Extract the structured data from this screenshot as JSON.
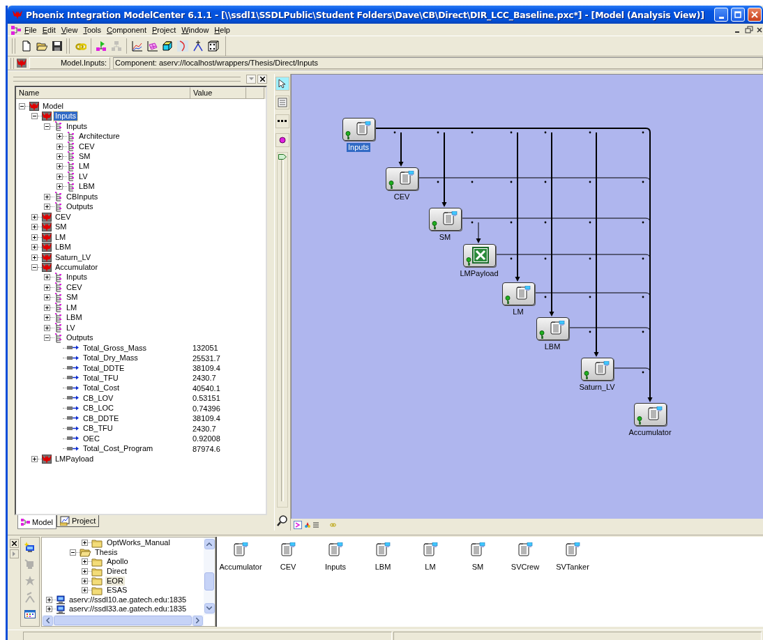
{
  "window": {
    "title": "Phoenix Integration ModelCenter 6.1.1 - [\\\\ssdl1\\SSDLPublic\\Student Folders\\Dave\\CB\\Direct\\DIR_LCC_Baseline.pxc*] - [Model (Analysis View)]"
  },
  "menu": [
    "File",
    "Edit",
    "View",
    "Tools",
    "Component",
    "Project",
    "Window",
    "Help"
  ],
  "toolbar": [
    {
      "disabled": false
    },
    {
      "disabled": false
    },
    {
      "disabled": false
    },
    {
      "disabled": false
    },
    {
      "disabled": false
    },
    {
      "disabled": true
    },
    {
      "disabled": false
    },
    {
      "disabled": false
    },
    {
      "disabled": false
    },
    {
      "disabled": false
    },
    {
      "disabled": false
    },
    {
      "disabled": false
    }
  ],
  "address_bar": {
    "label": "Model.Inputs:",
    "value": "Component: aserv://localhost/wrappers/Thesis/Direct/Inputs"
  },
  "model_tree": {
    "columns": [
      "Name",
      "Value"
    ],
    "items": [
      {
        "label": "Model",
        "kind": "model",
        "expanded": true,
        "selected": false,
        "children": [
          {
            "label": "Inputs",
            "kind": "component",
            "expanded": true,
            "selected": true,
            "children": [
              {
                "label": "Inputs",
                "kind": "group",
                "expanded": true,
                "selected": false,
                "children": [
                  {
                    "label": "Architecture",
                    "kind": "group",
                    "expanded": false,
                    "selected": false
                  },
                  {
                    "label": "CEV",
                    "kind": "group",
                    "expanded": false,
                    "selected": false
                  },
                  {
                    "label": "SM",
                    "kind": "group",
                    "expanded": false,
                    "selected": false
                  },
                  {
                    "label": "LM",
                    "kind": "group",
                    "expanded": false,
                    "selected": false
                  },
                  {
                    "label": "LV",
                    "kind": "group",
                    "expanded": false,
                    "selected": false
                  },
                  {
                    "label": "LBM",
                    "kind": "group",
                    "expanded": false,
                    "selected": false
                  }
                ]
              },
              {
                "label": "CBInputs",
                "kind": "group",
                "expanded": false,
                "selected": false
              },
              {
                "label": "Outputs",
                "kind": "group",
                "expanded": false,
                "selected": false
              }
            ]
          },
          {
            "label": "CEV",
            "kind": "component",
            "expanded": false,
            "selected": false
          },
          {
            "label": "SM",
            "kind": "component",
            "expanded": false,
            "selected": false
          },
          {
            "label": "LM",
            "kind": "component",
            "expanded": false,
            "selected": false
          },
          {
            "label": "LBM",
            "kind": "component",
            "expanded": false,
            "selected": false
          },
          {
            "label": "Saturn_LV",
            "kind": "component",
            "expanded": false,
            "selected": false
          },
          {
            "label": "Accumulator",
            "kind": "component",
            "expanded": true,
            "selected": false,
            "children": [
              {
                "label": "Inputs",
                "kind": "group",
                "expanded": false,
                "selected": false
              },
              {
                "label": "CEV",
                "kind": "group",
                "expanded": false,
                "selected": false
              },
              {
                "label": "SM",
                "kind": "group",
                "expanded": false,
                "selected": false
              },
              {
                "label": "LM",
                "kind": "group",
                "expanded": false,
                "selected": false
              },
              {
                "label": "LBM",
                "kind": "group",
                "expanded": false,
                "selected": false
              },
              {
                "label": "LV",
                "kind": "group",
                "expanded": false,
                "selected": false
              },
              {
                "label": "Outputs",
                "kind": "group",
                "expanded": true,
                "selected": false,
                "children": [
                  {
                    "label": "Total_Gross_Mass",
                    "kind": "variable",
                    "value": "132051",
                    "selected": false
                  },
                  {
                    "label": "Total_Dry_Mass",
                    "kind": "variable",
                    "value": "25531.7",
                    "selected": false
                  },
                  {
                    "label": "Total_DDTE",
                    "kind": "variable",
                    "value": "38109.4",
                    "selected": false
                  },
                  {
                    "label": "Total_TFU",
                    "kind": "variable",
                    "value": "2430.7",
                    "selected": false
                  },
                  {
                    "label": "Total_Cost",
                    "kind": "variable",
                    "value": "40540.1",
                    "selected": false
                  },
                  {
                    "label": "CB_LOV",
                    "kind": "variable",
                    "value": "0.53151",
                    "selected": false
                  },
                  {
                    "label": "CB_LOC",
                    "kind": "variable",
                    "value": "0.74396",
                    "selected": false
                  },
                  {
                    "label": "CB_DDTE",
                    "kind": "variable",
                    "value": "38109.4",
                    "selected": false
                  },
                  {
                    "label": "CB_TFU",
                    "kind": "variable",
                    "value": "2430.7",
                    "selected": false
                  },
                  {
                    "label": "OEC",
                    "kind": "variable",
                    "value": "0.92008",
                    "selected": false
                  },
                  {
                    "label": "Total_Cost_Program",
                    "kind": "variable",
                    "value": "87974.6",
                    "selected": false
                  }
                ]
              }
            ]
          },
          {
            "label": "LMPayload",
            "kind": "component",
            "expanded": false,
            "selected": false
          }
        ]
      }
    ]
  },
  "panel_tabs": [
    {
      "label": "Model",
      "selected": true
    },
    {
      "label": "Project",
      "selected": false
    }
  ],
  "zoom_slider": {
    "level": 1
  },
  "diagram": {
    "nodes": [
      {
        "label": "Inputs",
        "kind": "script",
        "selected": true
      },
      {
        "label": "CEV",
        "kind": "script",
        "selected": false
      },
      {
        "label": "SM",
        "kind": "script",
        "selected": false
      },
      {
        "label": "LMPayload",
        "kind": "spreadsheet",
        "selected": false
      },
      {
        "label": "LM",
        "kind": "script",
        "selected": false
      },
      {
        "label": "LBM",
        "kind": "script",
        "selected": false
      },
      {
        "label": "Saturn_LV",
        "kind": "script",
        "selected": false
      },
      {
        "label": "Accumulator",
        "kind": "script",
        "selected": false
      }
    ]
  },
  "dock_tools": [
    {
      "disabled": false
    },
    {
      "disabled": true
    },
    {
      "disabled": true
    },
    {
      "disabled": true
    },
    {
      "disabled": false
    }
  ],
  "library_tree": {
    "items": [
      {
        "kind": "scrolled",
        "children": [
          {
            "kind": "scrolled",
            "children": [
              {
                "kind": "scrolled",
                "children": [
                  {
                    "label": "OptWorks_Manual",
                    "kind": "folder",
                    "expanded": false,
                    "selected": false
                  }
                ]
              },
              {
                "label": "Thesis",
                "kind": "folder",
                "expanded": true,
                "selected": false,
                "children": [
                  {
                    "label": "Apollo",
                    "kind": "folder",
                    "expanded": false,
                    "selected": false
                  },
                  {
                    "label": "Direct",
                    "kind": "folder",
                    "expanded": false,
                    "selected": false
                  },
                  {
                    "label": "EOR",
                    "kind": "folder",
                    "expanded": false,
                    "selected": true
                  },
                  {
                    "label": "ESAS",
                    "kind": "folder",
                    "expanded": false,
                    "selected": false
                  }
                ]
              }
            ]
          }
        ]
      },
      {
        "label": "aserv://ssdl10.ae.gatech.edu:1835",
        "kind": "server",
        "expanded": false,
        "selected": false
      },
      {
        "label": "aserv://ssdl33.ae.gatech.edu:1835",
        "kind": "server",
        "expanded": false,
        "selected": false
      }
    ]
  },
  "palette": [
    "Accumulator",
    "CEV",
    "Inputs",
    "LBM",
    "LM",
    "SM",
    "SVCrew",
    "SVTanker"
  ]
}
